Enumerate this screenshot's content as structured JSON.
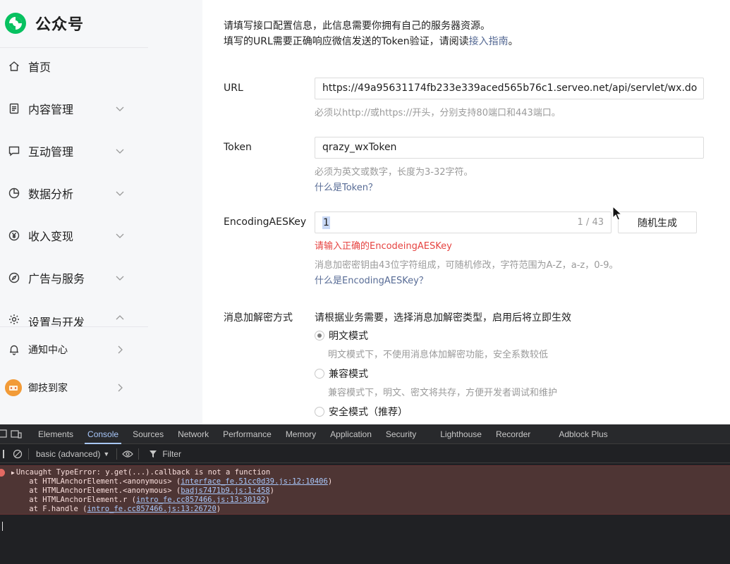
{
  "brand": {
    "name": "公众号"
  },
  "sidebar": {
    "items": [
      {
        "label": "首页",
        "icon": "home-icon"
      },
      {
        "label": "内容管理",
        "icon": "document-icon"
      },
      {
        "label": "互动管理",
        "icon": "chat-icon"
      },
      {
        "label": "数据分析",
        "icon": "pie-chart-icon"
      },
      {
        "label": "收入变现",
        "icon": "yen-icon"
      },
      {
        "label": "广告与服务",
        "icon": "compass-icon"
      },
      {
        "label": "设置与开发",
        "icon": "gear-icon"
      }
    ],
    "bottom": [
      {
        "label": "通知中心",
        "icon": "bell-icon"
      },
      {
        "label": "御技到家",
        "icon": "avatar"
      }
    ]
  },
  "intro": {
    "line1": "请填写接口配置信息，此信息需要你拥有自己的服务器资源。",
    "line2_prefix": "填写的URL需要正确响应微信发送的Token验证，请阅读",
    "line2_link": "接入指南",
    "line2_suffix": "。"
  },
  "form": {
    "url": {
      "label": "URL",
      "value": "https://49a95631174fb233e339aced565b76c1.serveo.net/api/servlet/wx.do",
      "hint": "必须以http://或https://开头，分别支持80端口和443端口。"
    },
    "token": {
      "label": "Token",
      "value": "qrazy_wxToken",
      "hint": "必须为英文或数字，长度为3-32字符。",
      "help_link": "什么是Token？"
    },
    "aes": {
      "label": "EncodingAESKey",
      "value": "1",
      "counter": "1 / 43",
      "random_button": "随机生成",
      "error": "请输入正确的EncodeingAESKey",
      "hint": "消息加密密钥由43位字符组成，可随机修改，字符范围为A-Z，a-z，0-9。",
      "help_link": "什么是EncodingAESKey？"
    },
    "encryption": {
      "label": "消息加解密方式",
      "description": "请根据业务需要，选择消息加解密类型，启用后将立即生效",
      "options": [
        {
          "label": "明文模式",
          "desc": "明文模式下，不使用消息体加解密功能，安全系数较低",
          "checked": true
        },
        {
          "label": "兼容模式",
          "desc": "兼容模式下，明文、密文将共存，方便开发者调试和维护",
          "checked": false
        },
        {
          "label": "安全模式（推荐）",
          "desc": "",
          "checked": false
        }
      ]
    }
  },
  "devtools": {
    "tabs": [
      "Elements",
      "Console",
      "Sources",
      "Network",
      "Performance",
      "Memory",
      "Application",
      "Security",
      "Lighthouse",
      "Recorder",
      "Adblock Plus"
    ],
    "active_tab": "Console",
    "level_select": "basic (advanced)",
    "filter_placeholder": "Filter",
    "error": {
      "message": "Uncaught TypeError: y.get(...).callback is not a function",
      "stack": [
        {
          "prefix": "    at HTMLAnchorElement.<anonymous> (",
          "src": "interface_fe.51cc0d39.js:12:10406",
          "suffix": ")"
        },
        {
          "prefix": "    at HTMLAnchorElement.<anonymous> (",
          "src": "badjs7471b9.js:1:458",
          "suffix": ")"
        },
        {
          "prefix": "    at HTMLAnchorElement.r (",
          "src": "intro_fe.cc857466.js:13:30192",
          "suffix": ")"
        },
        {
          "prefix": "    at F.handle (",
          "src": "intro_fe.cc857466.js:13:26720",
          "suffix": ")"
        }
      ]
    }
  },
  "colors": {
    "brand_green": "#07c160",
    "link": "#576b95",
    "error_text": "#e64340",
    "devtools_bg": "#202124",
    "console_error_bg": "#4e3534"
  }
}
